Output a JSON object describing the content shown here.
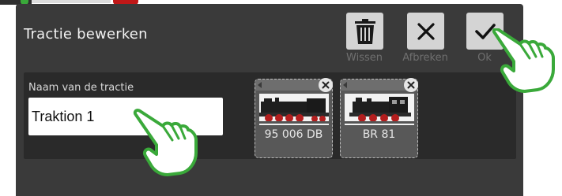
{
  "dialog": {
    "title": "Tractie bewerken"
  },
  "toolbar": {
    "delete_label": "Wissen",
    "cancel_label": "Afbreken",
    "ok_label": "Ok"
  },
  "form": {
    "name_label": "Naam van de tractie",
    "name_value": "Traktion 1"
  },
  "locomotives": [
    {
      "name": "95 006 DB"
    },
    {
      "name": "BR 81"
    }
  ],
  "icons": {
    "delete": "trash-icon",
    "cancel": "x-icon",
    "ok": "checkmark-icon",
    "remove": "close-icon",
    "hand": "pointing-hand-icon"
  },
  "colors": {
    "dialog_bg": "#3a3a3a",
    "content_bg": "#2a2a2a",
    "button_bg": "#d4d4d4",
    "hand_green": "#3aa93a"
  }
}
